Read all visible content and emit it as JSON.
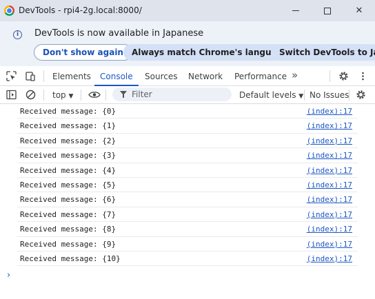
{
  "window": {
    "title": "DevTools - rpi4-2g.local:8000/",
    "close_glyph": "✕"
  },
  "infobar": {
    "message": "DevTools is now available in Japanese",
    "icon": "info-icon",
    "buttons": [
      "Don't show again",
      "Always match Chrome's language",
      "Switch DevTools to Japanese"
    ]
  },
  "tabs": {
    "items": [
      "Elements",
      "Console",
      "Sources",
      "Network",
      "Performance"
    ],
    "active": "Console",
    "more_glyph": "»"
  },
  "console_toolbar": {
    "context": "top",
    "filter_placeholder": "Filter",
    "levels": "Default levels",
    "issues": "No Issues"
  },
  "console": {
    "messages": [
      {
        "text": "Received message: {0}",
        "source": "(index):17"
      },
      {
        "text": "Received message: {1}",
        "source": "(index):17"
      },
      {
        "text": "Received message: {2}",
        "source": "(index):17"
      },
      {
        "text": "Received message: {3}",
        "source": "(index):17"
      },
      {
        "text": "Received message: {4}",
        "source": "(index):17"
      },
      {
        "text": "Received message: {5}",
        "source": "(index):17"
      },
      {
        "text": "Received message: {6}",
        "source": "(index):17"
      },
      {
        "text": "Received message: {7}",
        "source": "(index):17"
      },
      {
        "text": "Received message: {8}",
        "source": "(index):17"
      },
      {
        "text": "Received message: {9}",
        "source": "(index):17"
      },
      {
        "text": "Received message: {10}",
        "source": "(index):17"
      }
    ],
    "prompt_glyph": "›"
  },
  "colors": {
    "accent": "#1a56c4",
    "titlebar_bg": "#dfe3ec",
    "infobar_bg": "#edf1f8"
  }
}
